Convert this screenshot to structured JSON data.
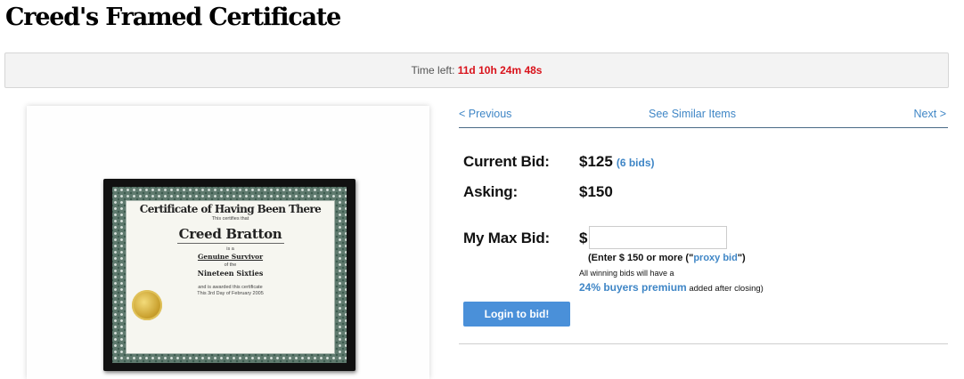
{
  "page": {
    "title": "Creed's Framed Certificate"
  },
  "timer": {
    "label": "Time left:",
    "value": "11d 10h 24m 48s"
  },
  "certificate": {
    "heading": "Certificate of Having Been There",
    "certifies": "This certifies that",
    "name": "Creed Bratton",
    "is_a": "is a",
    "line1": "Genuine Survivor",
    "of_the": "of the",
    "line2": "Nineteen Sixties",
    "awarded": "and is awarded this certificate",
    "date": "This 3rd Day of February 2005"
  },
  "nav": {
    "prev": "< Previous",
    "similar": "See Similar Items",
    "next": "Next >"
  },
  "bid": {
    "current_label": "Current Bid:",
    "current_value": "$125",
    "bids_link": "(6 bids)",
    "asking_label": "Asking:",
    "asking_value": "$150",
    "max_label": "My Max Bid:",
    "currency": "$",
    "max_value": "",
    "hint_prefix": "(Enter $ 150 or more (\"",
    "hint_link": "proxy bid",
    "hint_suffix": "\")",
    "notice_line1": "All winning bids will have a",
    "premium_link": "24% buyers premium",
    "premium_suffix": " added after closing)",
    "login_button": "Login to bid!"
  },
  "colors": {
    "link": "#3f86c6",
    "timer": "#d9121b",
    "button": "#4a90d9"
  }
}
